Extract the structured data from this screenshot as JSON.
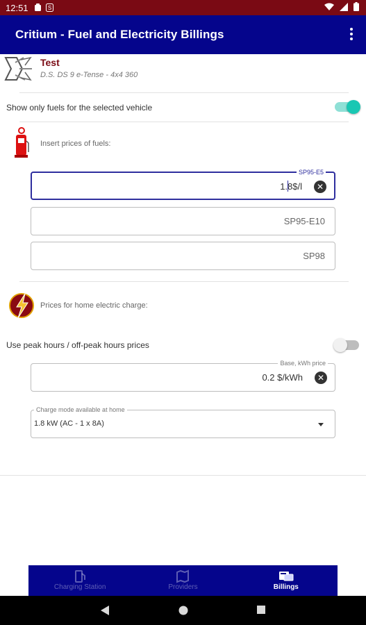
{
  "status_bar": {
    "time": "12:51"
  },
  "app_bar": {
    "title": "Critium - Fuel and Electricity Billings",
    "menu_icon": "more-vert-icon"
  },
  "vehicle": {
    "name": "Test",
    "model": "D.S. DS 9 e-Tense - 4x4 360"
  },
  "fuel_filter": {
    "label": "Show only fuels for the selected vehicle",
    "enabled": true
  },
  "fuels_section": {
    "title": "Insert prices of fuels:",
    "icon": "fuel-pump-icon",
    "fields": [
      {
        "label": "SP95-E5",
        "value": "1.8",
        "unit": "$/l",
        "focused": true
      },
      {
        "placeholder": "SP95-E10"
      },
      {
        "placeholder": "SP98"
      }
    ]
  },
  "electric_section": {
    "title": "Prices for home electric charge:",
    "icon": "lightning-icon",
    "peak_toggle": {
      "label": "Use peak hours / off-peak hours prices",
      "enabled": false
    },
    "base_price": {
      "label": "Base, kWh price",
      "value": "0.2",
      "unit": "$/kWh"
    },
    "charge_mode": {
      "label": "Charge mode available at home",
      "value": "1.8 kW (AC - 1 x 8A)"
    }
  },
  "bottom_nav": {
    "items": [
      {
        "label": "Charging Station",
        "icon": "charging-station-icon",
        "active": false
      },
      {
        "label": "Providers",
        "icon": "map-icon",
        "active": false
      },
      {
        "label": "Billings",
        "icon": "billings-icon",
        "active": true
      }
    ]
  },
  "colors": {
    "status_bar": "#7a0a14",
    "app_bar": "#05058c",
    "accent": "#19c7b3",
    "focus": "#2e2e9e",
    "vehicle_name": "#7a0a14"
  }
}
